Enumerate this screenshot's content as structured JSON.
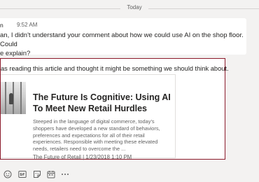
{
  "date_separator": "Today",
  "message1": {
    "author": "n",
    "time": "9:52 AM",
    "line1": "an, I didn't understand your comment about how we could use AI on the shop floor. Could",
    "line2": "e explain?"
  },
  "message2": {
    "intro": "as reading this article and thought it might be something we should think about.",
    "card": {
      "title": "The Future Is Cognitive: Using AI To Meet New Retail Hurdles",
      "description": "Steeped in the language of digital commerce, today's shoppers have developed a new standard of behaviors, preferences and expectations for all of their retail experiences. Responsible with meeting these elevated needs, retailers need to overcome the ...",
      "source": "The Future of Retail | 1/23/2018 1:10 PM"
    }
  },
  "toolbar": {
    "icons": [
      "emoji-icon",
      "gif-icon",
      "sticker-icon",
      "meet-now-icon",
      "more-options-icon"
    ]
  },
  "colors": {
    "highlight_border": "#8b1a2b",
    "background": "#f3f2f1",
    "message_bg": "#ffffff"
  }
}
